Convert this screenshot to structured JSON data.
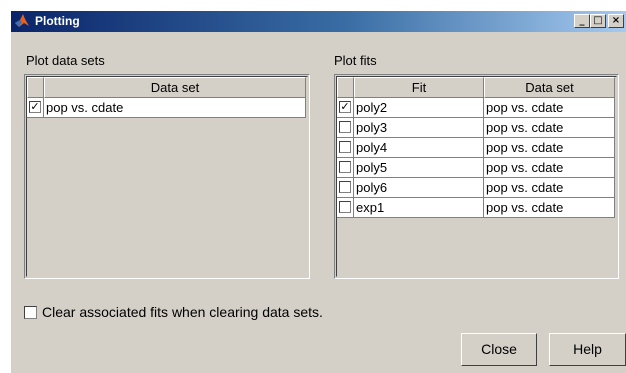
{
  "window": {
    "title": "Plotting",
    "controls": {
      "minimize": "_",
      "maximize": "□",
      "close": "×"
    }
  },
  "data_sets_panel": {
    "label": "Plot data sets",
    "column_header": "Data set",
    "rows": [
      {
        "checked": true,
        "data_set": "pop vs. cdate"
      }
    ]
  },
  "fits_panel": {
    "label": "Plot fits",
    "column_headers": {
      "fit": "Fit",
      "data_set": "Data set"
    },
    "rows": [
      {
        "checked": true,
        "fit": "poly2",
        "data_set": "pop vs. cdate"
      },
      {
        "checked": false,
        "fit": "poly3",
        "data_set": "pop vs. cdate"
      },
      {
        "checked": false,
        "fit": "poly4",
        "data_set": "pop vs. cdate"
      },
      {
        "checked": false,
        "fit": "poly5",
        "data_set": "pop vs. cdate"
      },
      {
        "checked": false,
        "fit": "poly6",
        "data_set": "pop vs. cdate"
      },
      {
        "checked": false,
        "fit": "exp1",
        "data_set": "pop vs. cdate"
      }
    ]
  },
  "clear_option": {
    "checked": false,
    "label": "Clear associated fits when clearing data sets."
  },
  "buttons": {
    "close": "Close",
    "help": "Help"
  }
}
